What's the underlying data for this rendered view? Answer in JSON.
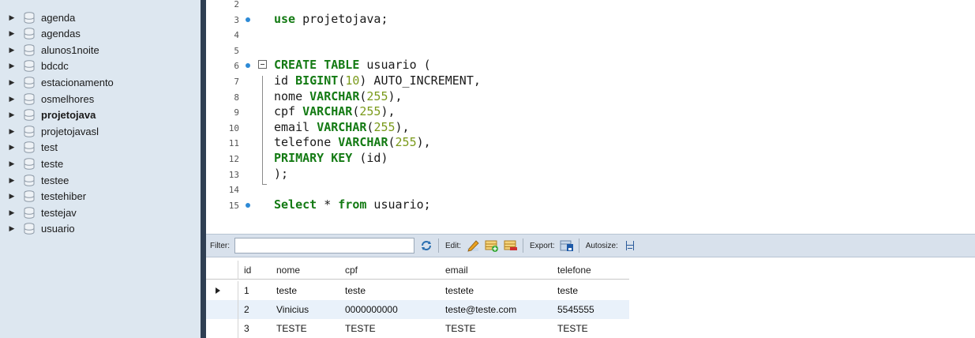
{
  "sidebar": {
    "schemas": [
      {
        "name": "agenda",
        "bold": false
      },
      {
        "name": "agendas",
        "bold": false
      },
      {
        "name": "alunos1noite",
        "bold": false
      },
      {
        "name": "bdcdc",
        "bold": false
      },
      {
        "name": "estacionamento",
        "bold": false
      },
      {
        "name": "osmelhores",
        "bold": false
      },
      {
        "name": "projetojava",
        "bold": true
      },
      {
        "name": "projetojavasl",
        "bold": false
      },
      {
        "name": "test",
        "bold": false
      },
      {
        "name": "teste",
        "bold": false
      },
      {
        "name": "testee",
        "bold": false
      },
      {
        "name": "testehiber",
        "bold": false
      },
      {
        "name": "testejav",
        "bold": false
      },
      {
        "name": "usuario",
        "bold": false
      }
    ],
    "expand_icon": "triangle-right-icon",
    "schema_icon": "database-icon"
  },
  "editor": {
    "lines": [
      {
        "num": "2",
        "dot": false,
        "fold": false,
        "tokens": []
      },
      {
        "num": "3",
        "dot": true,
        "fold": false,
        "tokens": [
          [
            "kw",
            "use"
          ],
          [
            "t",
            " projetojava;"
          ]
        ]
      },
      {
        "num": "4",
        "dot": false,
        "fold": false,
        "tokens": []
      },
      {
        "num": "5",
        "dot": false,
        "fold": false,
        "tokens": []
      },
      {
        "num": "6",
        "dot": true,
        "fold": true,
        "tokens": [
          [
            "kw",
            "CREATE TABLE"
          ],
          [
            "t",
            " usuario ("
          ]
        ]
      },
      {
        "num": "7",
        "dot": false,
        "fold": false,
        "tokens": [
          [
            "t",
            "id "
          ],
          [
            "kw",
            "BIGINT"
          ],
          [
            "t",
            "("
          ],
          [
            "num",
            "10"
          ],
          [
            "t",
            ") AUTO_INCREMENT,"
          ]
        ]
      },
      {
        "num": "8",
        "dot": false,
        "fold": false,
        "tokens": [
          [
            "t",
            "nome "
          ],
          [
            "kw",
            "VARCHAR"
          ],
          [
            "t",
            "("
          ],
          [
            "num",
            "255"
          ],
          [
            "t",
            "),"
          ]
        ]
      },
      {
        "num": "9",
        "dot": false,
        "fold": false,
        "tokens": [
          [
            "t",
            "cpf "
          ],
          [
            "kw",
            "VARCHAR"
          ],
          [
            "t",
            "("
          ],
          [
            "num",
            "255"
          ],
          [
            "t",
            "),"
          ]
        ]
      },
      {
        "num": "10",
        "dot": false,
        "fold": false,
        "tokens": [
          [
            "t",
            "email "
          ],
          [
            "kw",
            "VARCHAR"
          ],
          [
            "t",
            "("
          ],
          [
            "num",
            "255"
          ],
          [
            "t",
            "),"
          ]
        ]
      },
      {
        "num": "11",
        "dot": false,
        "fold": false,
        "tokens": [
          [
            "t",
            "telefone "
          ],
          [
            "kw",
            "VARCHAR"
          ],
          [
            "t",
            "("
          ],
          [
            "num",
            "255"
          ],
          [
            "t",
            "),"
          ]
        ]
      },
      {
        "num": "12",
        "dot": false,
        "fold": false,
        "tokens": [
          [
            "kw",
            "PRIMARY KEY"
          ],
          [
            "t",
            " (id)"
          ]
        ]
      },
      {
        "num": "13",
        "dot": false,
        "fold": false,
        "tokens": [
          [
            "t",
            ");"
          ]
        ]
      },
      {
        "num": "14",
        "dot": false,
        "fold": false,
        "tokens": []
      },
      {
        "num": "15",
        "dot": true,
        "fold": false,
        "tokens": [
          [
            "kw",
            "Select"
          ],
          [
            "t",
            " * "
          ],
          [
            "kw",
            "from"
          ],
          [
            "t",
            " usuario;"
          ]
        ]
      }
    ],
    "colors": {
      "keyword": "#137a13",
      "number": "#7a9a1a",
      "dot": "#2d8ad6"
    }
  },
  "results": {
    "toolbar": {
      "filter_label": "Filter:",
      "filter_value": "",
      "edit_label": "Edit:",
      "export_label": "Export:",
      "autosize_label": "Autosize:",
      "icons": [
        "refresh-icon",
        "edit-pencil-icon",
        "add-row-icon",
        "delete-row-icon",
        "export-icon",
        "autosize-icon"
      ]
    },
    "columns": [
      "id",
      "nome",
      "cpf",
      "email",
      "telefone"
    ],
    "rows": [
      [
        "1",
        "teste",
        "teste",
        "testete",
        "teste"
      ],
      [
        "2",
        "Vinicius",
        "0000000000",
        "teste@teste.com",
        "5545555"
      ],
      [
        "3",
        "TESTE",
        "TESTE",
        "TESTE",
        "TESTE"
      ]
    ],
    "selected_row": 0
  }
}
